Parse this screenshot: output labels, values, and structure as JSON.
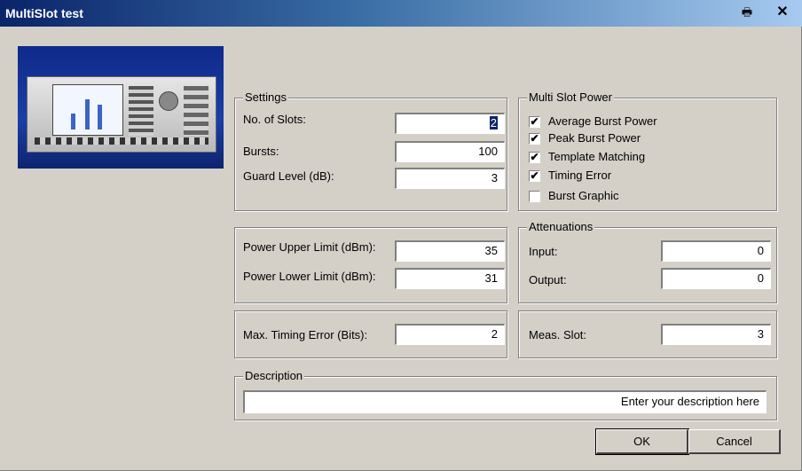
{
  "window": {
    "title": "MultiSlot test"
  },
  "icons": {
    "print": "printer-icon",
    "close": "close-icon"
  },
  "settings": {
    "legend": "Settings",
    "slots_label": "No. of Slots:",
    "slots_value": "2",
    "bursts_label": "Bursts:",
    "bursts_value": "100",
    "guard_label": "Guard Level (dB):",
    "guard_value": "3"
  },
  "multislot": {
    "legend": "Multi Slot Power",
    "items": [
      {
        "label": "Average Burst Power",
        "checked": "✔"
      },
      {
        "label": "Peak Burst Power",
        "checked": "✔"
      },
      {
        "label": "Template Matching",
        "checked": "✔"
      },
      {
        "label": "Timing Error",
        "checked": "✔"
      },
      {
        "label": "Burst Graphic",
        "checked": ""
      }
    ]
  },
  "limits": {
    "upper_label": "Power Upper Limit (dBm):",
    "upper_value": "35",
    "lower_label": "Power Lower Limit (dBm):",
    "lower_value": "31"
  },
  "attenuations": {
    "legend": "Attenuations",
    "input_label": "Input:",
    "input_value": "0",
    "output_label": "Output:",
    "output_value": "0"
  },
  "timing": {
    "label": "Max. Timing Error (Bits):",
    "value": "2"
  },
  "meas": {
    "label": "Meas. Slot:",
    "value": "3"
  },
  "description": {
    "legend": "Description",
    "value": "Enter your description here"
  },
  "buttons": {
    "ok": "OK",
    "cancel": "Cancel"
  },
  "colors": {
    "title_bar": "#0a246a",
    "dialog_bg": "#d4d0c8",
    "device_bg": "#1a3fa8"
  }
}
